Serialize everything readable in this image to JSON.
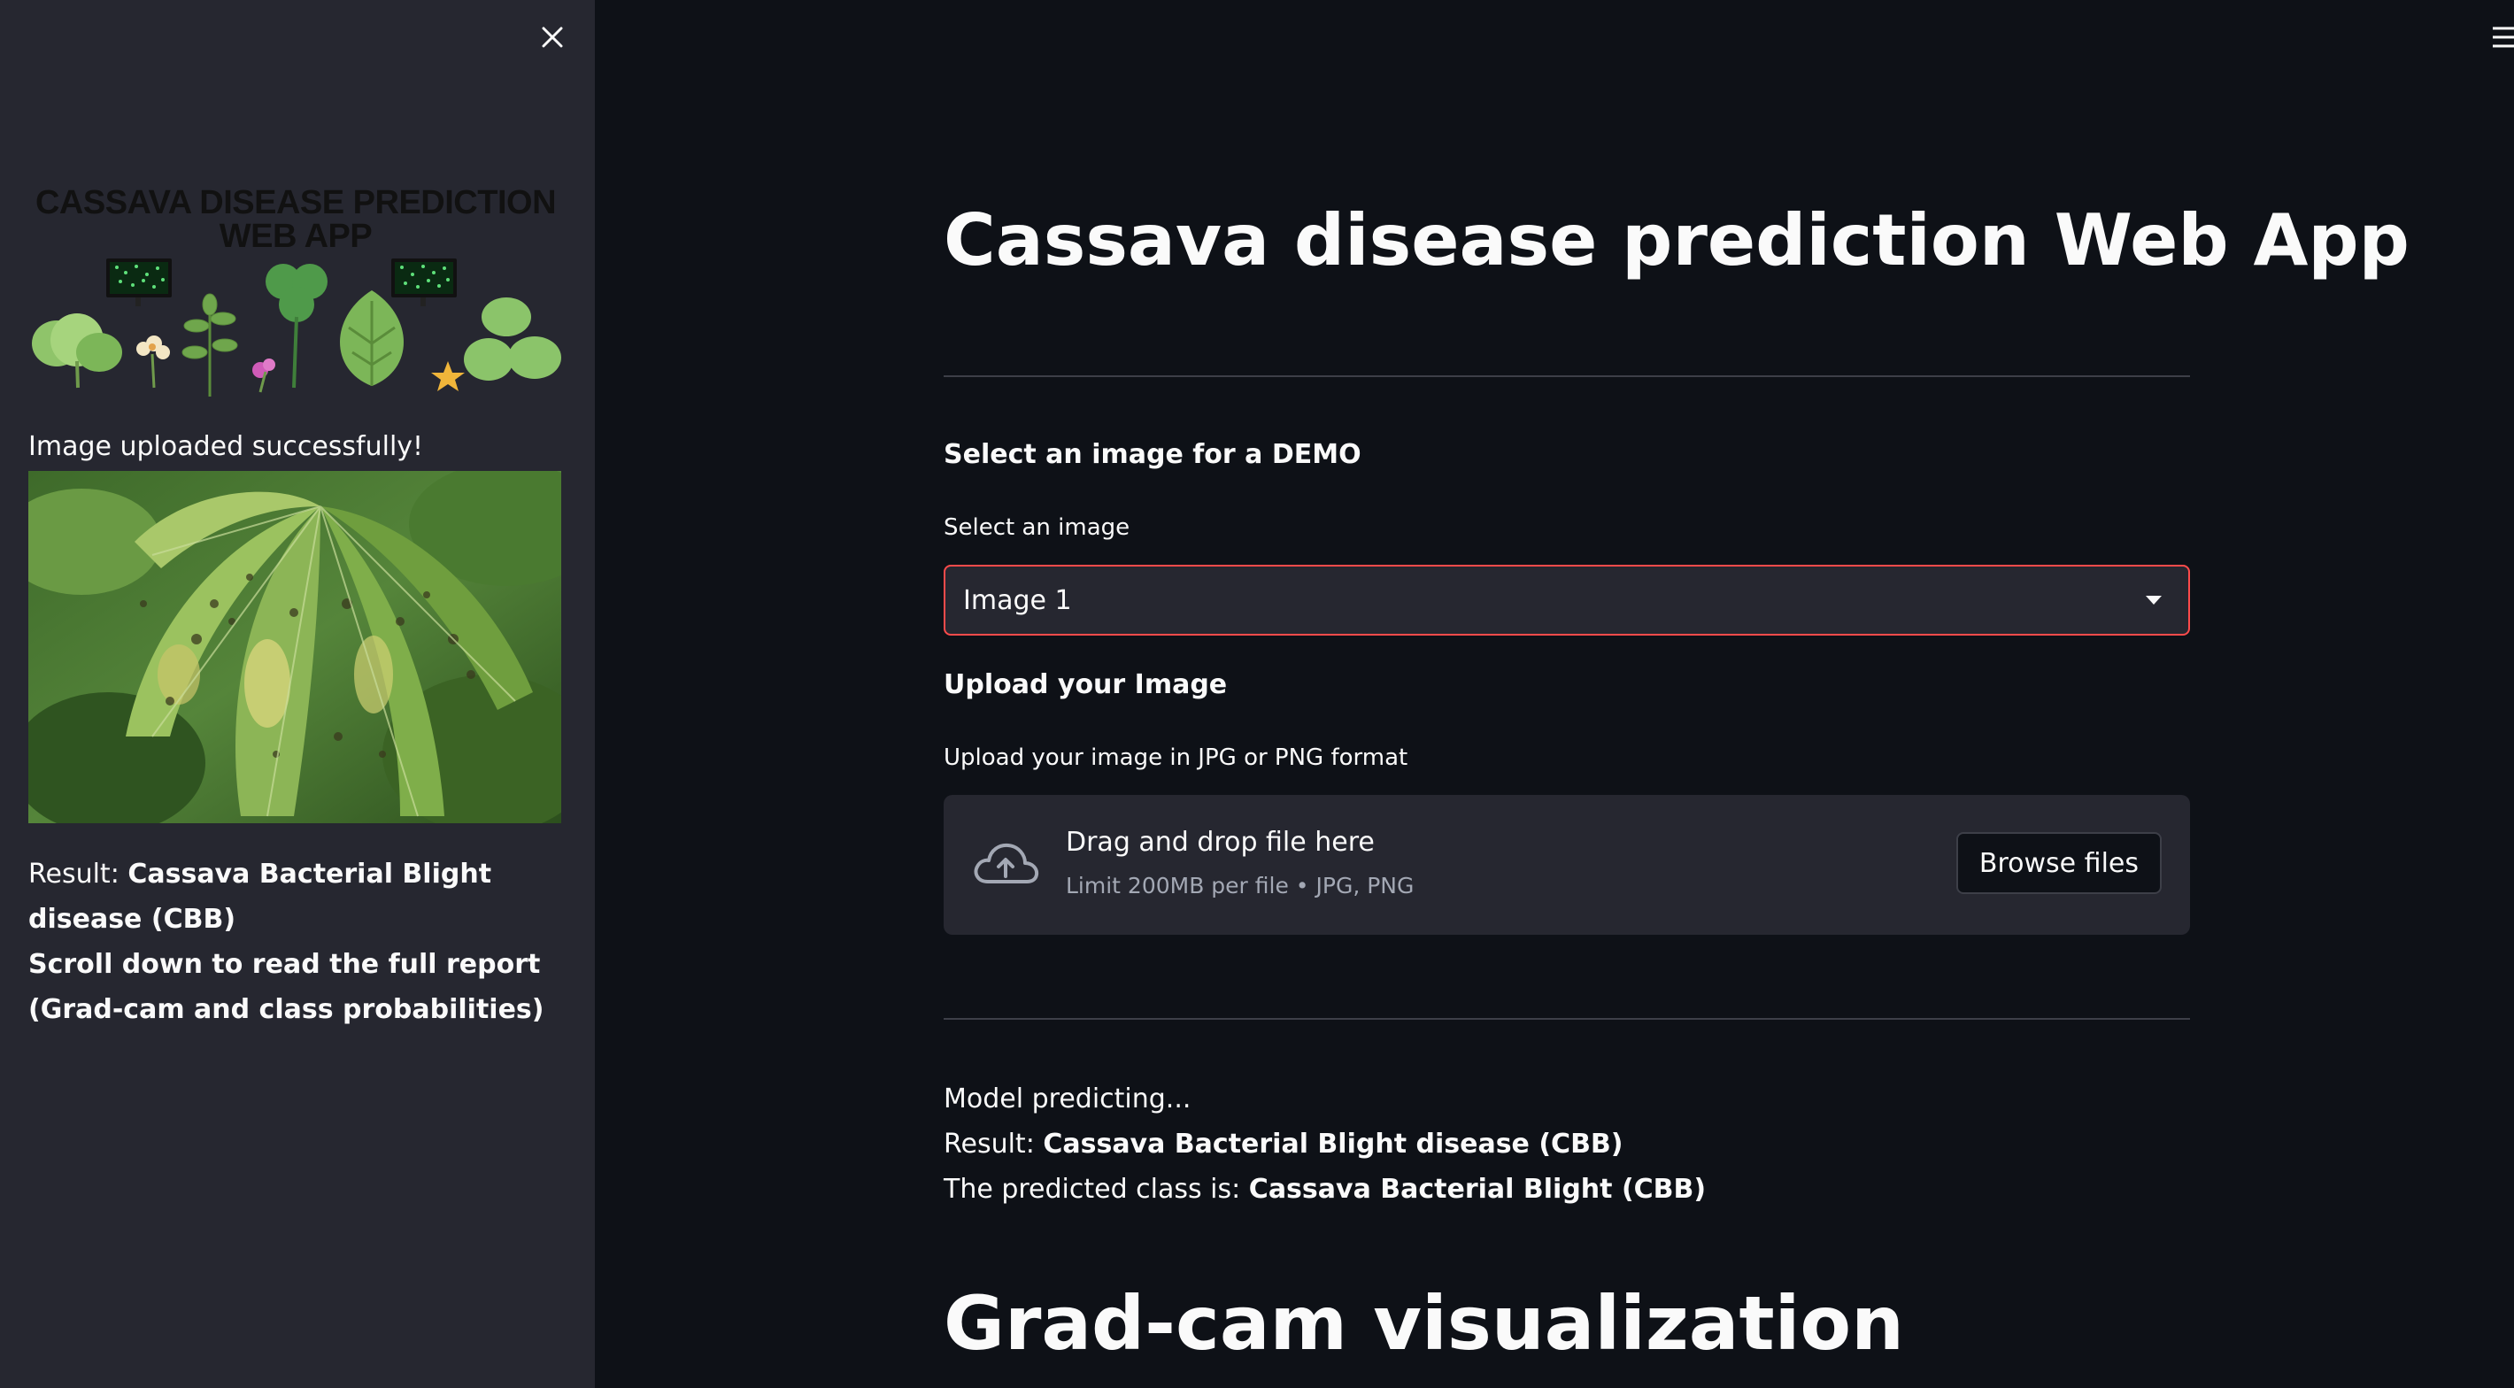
{
  "sidebar": {
    "logo_text_line1": "CASSAVA DISEASE PREDICTION",
    "logo_text_line2": "WEB APP",
    "upload_message": "Image uploaded successfully!",
    "result_prefix": "Result: ",
    "result_value": "Cassava Bacterial Blight disease (CBB)",
    "scroll_note": "Scroll down to read the full report (Grad-cam and class probabilities)"
  },
  "main": {
    "title": "Cassava disease prediction Web App",
    "demo_section_label": "Select an image for a DEMO",
    "select_label": "Select an image",
    "select_value": "Image 1",
    "upload_section_label": "Upload your Image",
    "uploader_label": "Upload your image in JPG or PNG format",
    "dropzone_title": "Drag and drop file here",
    "dropzone_limit": "Limit 200MB per file • JPG, PNG",
    "browse_button": "Browse files",
    "predicting_text": "Model predicting...",
    "result_prefix": "Result: ",
    "result_value": "Cassava Bacterial Blight disease (CBB)",
    "predicted_prefix": "The predicted class is: ",
    "predicted_value": "Cassava Bacterial Blight (CBB)",
    "gradcam_heading": "Grad-cam visualization"
  },
  "colors": {
    "app_background": "#0e1117",
    "sidebar_background": "#262730",
    "accent": "#ff4b4b",
    "text": "#fafafa",
    "muted_text": "#a3a8b4"
  },
  "icons": {
    "close": "close-icon",
    "menu": "hamburger-menu-icon",
    "dropdown": "chevron-down-icon",
    "upload": "cloud-upload-icon"
  }
}
